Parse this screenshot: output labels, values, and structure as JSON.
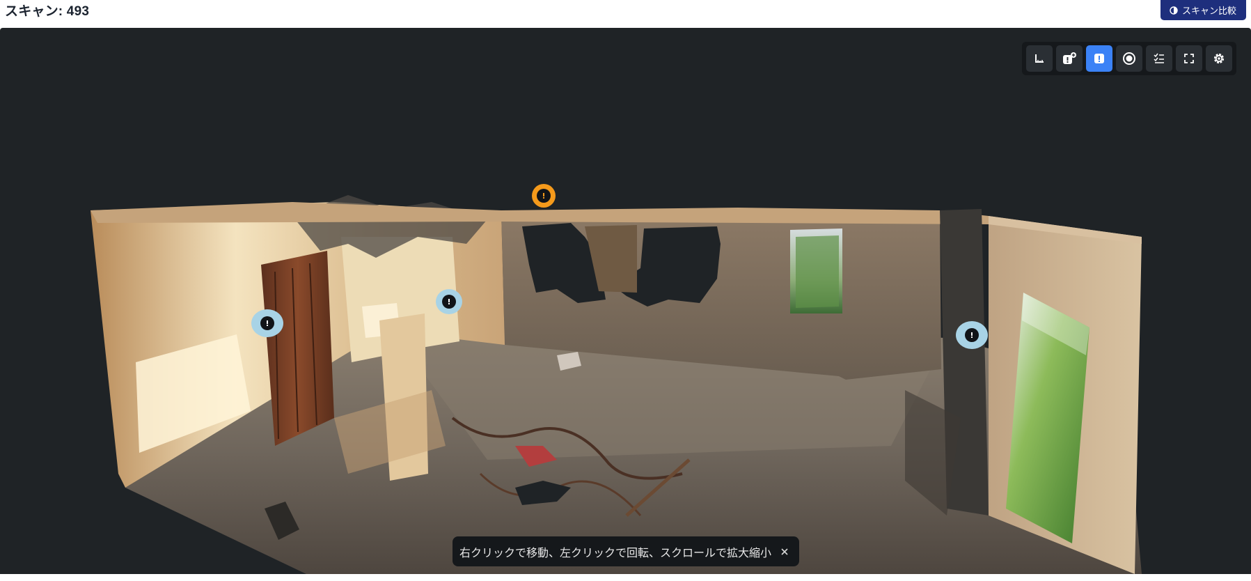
{
  "header": {
    "title": "スキャン: 493",
    "compare_button_label": "スキャン比較",
    "compare_icon": "half-circle-icon"
  },
  "colors": {
    "header_button_bg": "#1e2f7d",
    "viewer_bg": "#1f2326",
    "toolbar_bg": "#15181b",
    "tool_active": "#3b82f6",
    "issue_marker_ring": "#a8d3e6",
    "issue_marker_highlight": "#f59a1b"
  },
  "toolbar": {
    "tools": [
      {
        "name": "measure",
        "icon": "ruler-icon",
        "active": false
      },
      {
        "name": "add-issue",
        "icon": "issue-add-icon",
        "active": false
      },
      {
        "name": "show-issues",
        "icon": "issue-icon",
        "active": true
      },
      {
        "name": "points",
        "icon": "target-icon",
        "active": false
      },
      {
        "name": "checklist",
        "icon": "checklist-icon",
        "active": false
      },
      {
        "name": "fullscreen",
        "icon": "fullscreen-icon",
        "active": false
      },
      {
        "name": "settings",
        "icon": "gear-icon",
        "active": false
      }
    ]
  },
  "markers": [
    {
      "name": "issue-marker-1",
      "style": "highlighted"
    },
    {
      "name": "issue-marker-2",
      "style": "normal"
    },
    {
      "name": "issue-marker-3",
      "style": "normal"
    },
    {
      "name": "issue-marker-4",
      "style": "normal"
    }
  ],
  "hint": {
    "text": "右クリックで移動、左クリックで回転、スクロールで拡大縮小"
  }
}
